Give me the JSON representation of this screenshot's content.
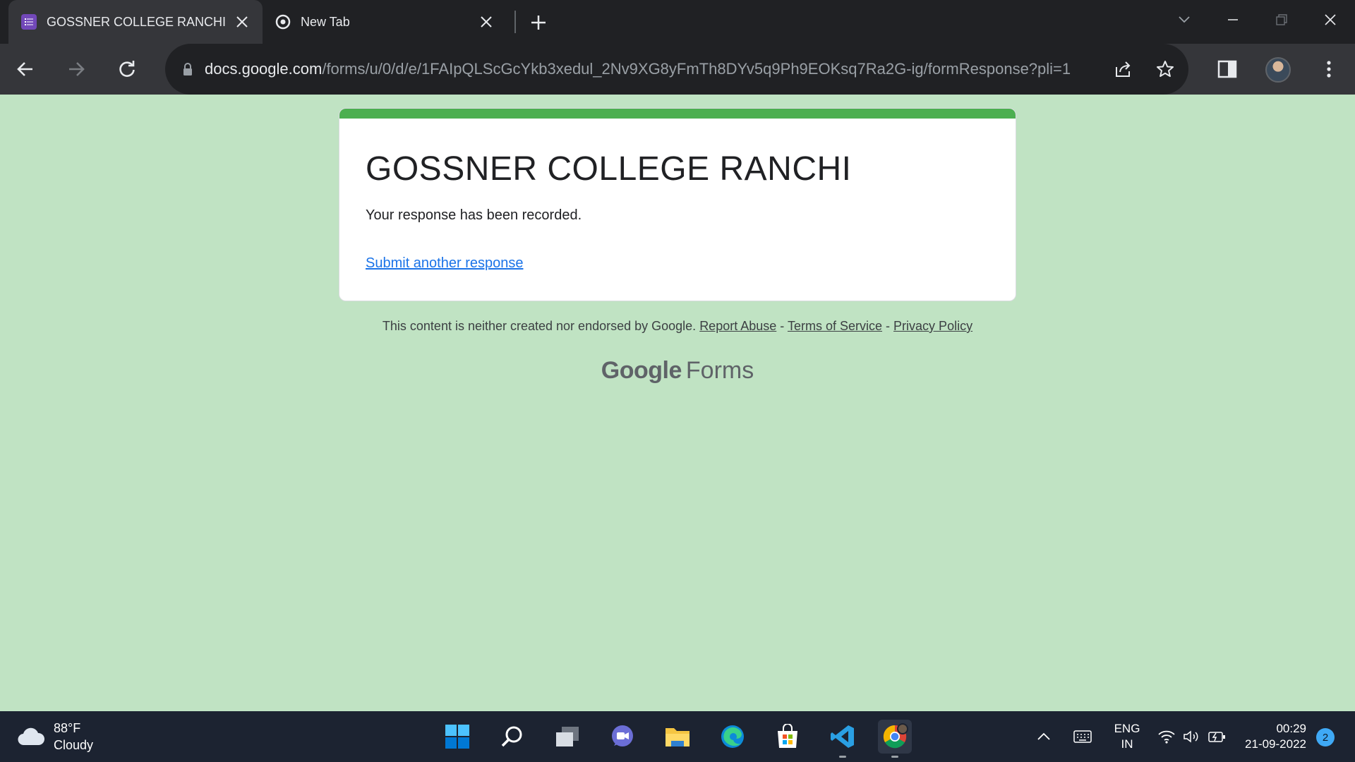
{
  "browser": {
    "tabs": [
      {
        "title": "GOSSNER COLLEGE RANCHI",
        "active": true,
        "icon": "google-forms-icon"
      },
      {
        "title": "New Tab",
        "active": false,
        "icon": "chrome-icon"
      }
    ],
    "url_host": "docs.google.com",
    "url_path": "/forms/u/0/d/e/1FAIpQLScGcYkb3xedul_2Nv9XG8yFmTh8DYv5q9Ph9EOKsq7Ra2G-ig/formResponse?pli=1"
  },
  "form": {
    "title": "GOSSNER COLLEGE RANCHI",
    "message": "Your response has been recorded.",
    "link": "Submit another response",
    "accent_color": "#4caf50"
  },
  "footer": {
    "disclaimer": "This content is neither created nor endorsed by Google.",
    "report_abuse": "Report Abuse",
    "terms": "Terms of Service",
    "privacy": "Privacy Policy",
    "sep": "-",
    "brand_google": "Google",
    "brand_forms": "Forms"
  },
  "taskbar": {
    "temperature": "88°F",
    "condition": "Cloudy",
    "lang_top": "ENG",
    "lang_bottom": "IN",
    "time": "00:29",
    "date": "21-09-2022",
    "notifications": "2"
  }
}
